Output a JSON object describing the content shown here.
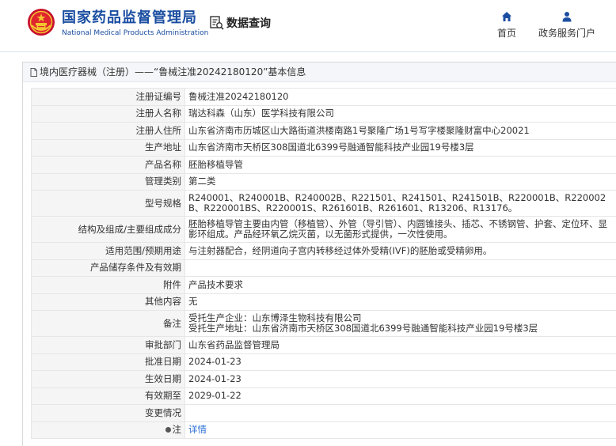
{
  "header": {
    "site_name_cn": "国家药品监督管理局",
    "site_name_en": "National Medical Products Administration",
    "query_label": "数据查询",
    "nav": [
      {
        "label": "首页",
        "icon": "home-icon"
      },
      {
        "label": "政务服务门户",
        "icon": "user-icon"
      }
    ]
  },
  "panel": {
    "title": "境内医疗器械（注册）——“鲁械注准20242180120”基本信息"
  },
  "fields": [
    {
      "label": "注册证编号",
      "value": "鲁械注准20242180120"
    },
    {
      "label": "注册人名称",
      "value": "瑞达科森（山东）医学科技有限公司"
    },
    {
      "label": "注册人住所",
      "value": "山东省济南市历城区山大路街道洪楼南路1号聚隆广场1号写字楼聚隆财富中心20021"
    },
    {
      "label": "生产地址",
      "value": "山东省济南市天桥区308国道北6399号融通智能科技产业园19号楼3层"
    },
    {
      "label": "产品名称",
      "value": "胚胎移植导管"
    },
    {
      "label": "管理类别",
      "value": "第二类"
    },
    {
      "label": "型号规格",
      "value": "R240001、R240001B、R240002B、R221501、R241501、R241501B、R220001B、R220002B、R220001BS、R220001S、R261601B、R261601、R13206、R13176。"
    },
    {
      "label": "结构及组成/主要组成成分",
      "value": "胚胎移植导管主要由内管（移植管）、外管（导引管）、内圆锥接头、插芯、不锈钢管、护套、定位环、显影环组成。产品经环氧乙烷灭菌，以无菌形式提供，一次性使用。"
    },
    {
      "label": "适用范围/预期用途",
      "value": "与注射器配合，经阴道向子宫内转移经过体外受精(IVF)的胚胎或受精卵用。"
    },
    {
      "label": "产品储存条件及有效期",
      "value": ""
    },
    {
      "label": "附件",
      "value": "产品技术要求"
    },
    {
      "label": "其他内容",
      "value": "无"
    },
    {
      "label": "备注",
      "value_lines": [
        "受托生产企业：山东博泽生物科技有限公司",
        "受托生产地址：山东省济南市天桥区308国道北6399号融通智能科技产业园19号楼3层"
      ]
    },
    {
      "label": "审批部门",
      "value": "山东省药品监督管理局"
    },
    {
      "label": "批准日期",
      "value": "2024-01-23"
    },
    {
      "label": "生效日期",
      "value": "2024-01-23"
    },
    {
      "label": "有效期至",
      "value": "2029-01-22"
    },
    {
      "label": "变更情况",
      "value": ""
    },
    {
      "label": "注",
      "link": "详情",
      "icon": "dot-icon"
    }
  ],
  "colors": {
    "brand": "#1b4ea1",
    "link": "#2a6fd6",
    "label_bg": "#f5f5f5"
  }
}
